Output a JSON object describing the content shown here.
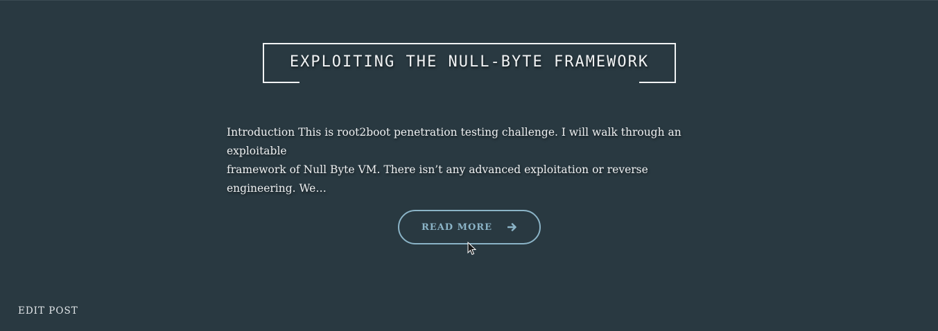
{
  "post": {
    "title": "EXPLOITING THE NULL-BYTE FRAMEWORK",
    "excerpt_line1": "Introduction This is root2boot penetration testing challenge. I will walk through an exploitable",
    "excerpt_line2": "framework of Null Byte VM. There isn’t any advanced exploitation or reverse engineering. We…",
    "read_more_label": "READ MORE",
    "read_more_icon": "arrow-right-icon"
  },
  "footer": {
    "edit_post_label": "EDIT POST"
  },
  "colors": {
    "background": "#293941",
    "accent": "#8bb4c7",
    "text": "#eef0f1"
  }
}
